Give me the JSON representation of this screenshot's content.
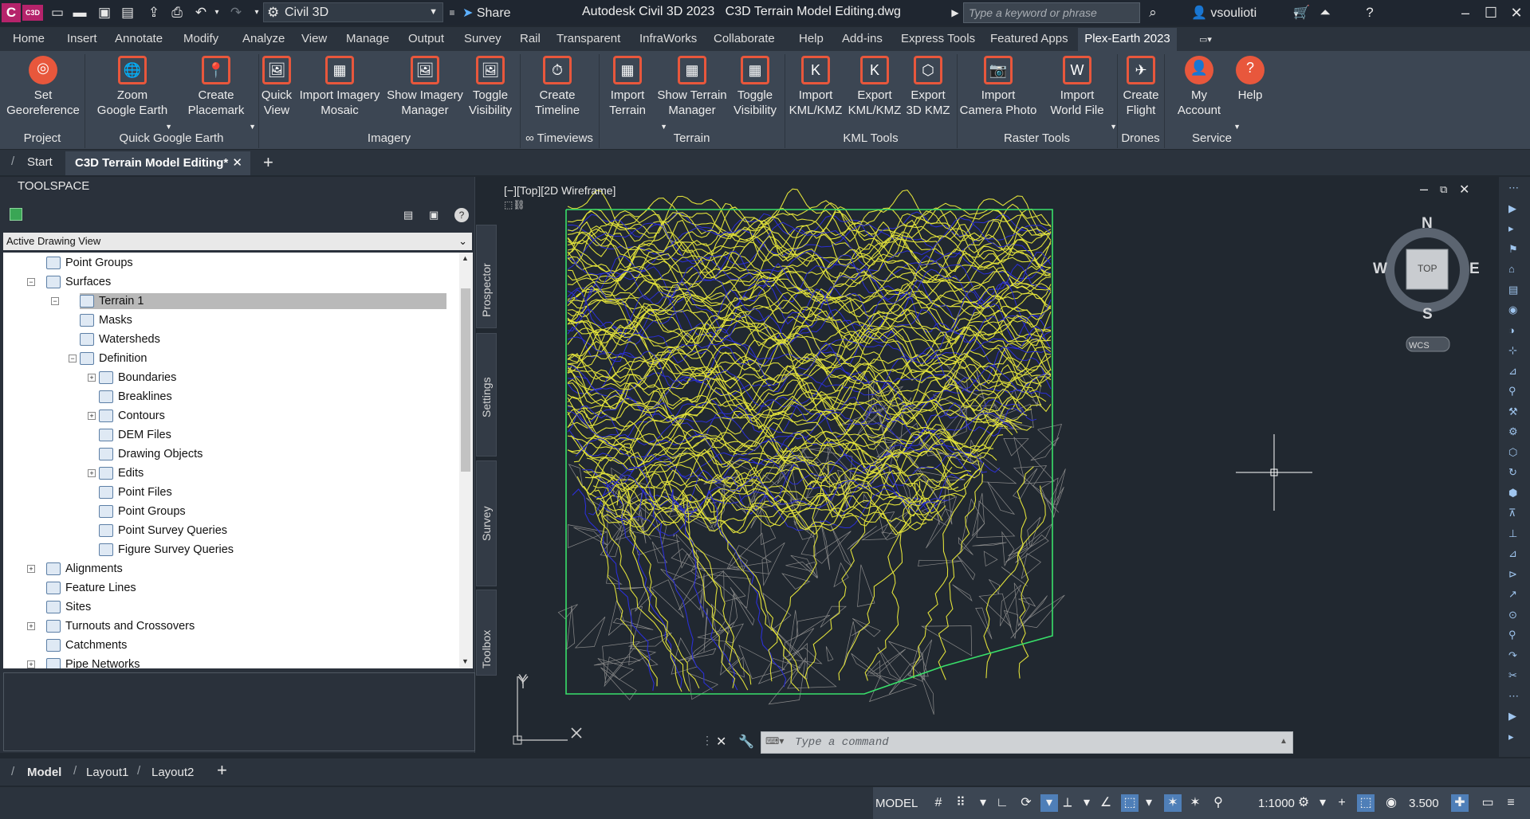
{
  "title_bar": {
    "logo": "C",
    "product_badge": "C3D",
    "workspace": "Civil 3D",
    "share": "Share",
    "app_title": "Autodesk Civil 3D 2023",
    "doc_title": "C3D Terrain Model Editing.dwg",
    "search_placeholder": "Type a keyword or phrase",
    "user": "vsoulioti"
  },
  "menu_tabs": [
    "Home",
    "Insert",
    "Annotate",
    "Modify",
    "Analyze",
    "View",
    "Manage",
    "Output",
    "Survey",
    "Rail",
    "Transparent",
    "InfraWorks",
    "Collaborate",
    "Help",
    "Add-ins",
    "Express Tools",
    "Featured Apps"
  ],
  "active_tab": "Plex-Earth 2023",
  "ribbon": {
    "buttons": [
      {
        "l1": "Set",
        "l2": "Georeference"
      },
      {
        "l1": "Zoom",
        "l2": "Google Earth"
      },
      {
        "l1": "Create",
        "l2": "Placemark"
      },
      {
        "l1": "Quick",
        "l2": "View"
      },
      {
        "l1": "Import Imagery",
        "l2": "Mosaic"
      },
      {
        "l1": "Show Imagery",
        "l2": "Manager"
      },
      {
        "l1": "Toggle",
        "l2": "Visibility"
      },
      {
        "l1": "Create",
        "l2": "Timeline"
      },
      {
        "l1": "Import",
        "l2": "Terrain"
      },
      {
        "l1": "Show Terrain",
        "l2": "Manager"
      },
      {
        "l1": "Toggle",
        "l2": "Visibility"
      },
      {
        "l1": "Import",
        "l2": "KML/KMZ"
      },
      {
        "l1": "Export",
        "l2": "KML/KMZ"
      },
      {
        "l1": "Export",
        "l2": "3D KMZ"
      },
      {
        "l1": "Import",
        "l2": "Camera Photo"
      },
      {
        "l1": "Import",
        "l2": "World File"
      },
      {
        "l1": "Create",
        "l2": "Flight"
      },
      {
        "l1": "My",
        "l2": "Account"
      },
      {
        "l1": "Help",
        "l2": ""
      }
    ],
    "groups": [
      "Project",
      "Quick Google Earth",
      "Imagery",
      "∞ Timeviews",
      "Terrain",
      "KML Tools",
      "Raster Tools",
      "Drones",
      "Service"
    ]
  },
  "doc_tabs": {
    "start": "Start",
    "active": "C3D Terrain Model Editing*"
  },
  "toolspace": {
    "title": "TOOLSPACE",
    "view": "Active Drawing View",
    "tree": [
      "Point Groups",
      "Surfaces",
      "Terrain 1",
      "Masks",
      "Watersheds",
      "Definition",
      "Boundaries",
      "Breaklines",
      "Contours",
      "DEM Files",
      "Drawing Objects",
      "Edits",
      "Point Files",
      "Point Groups",
      "Point Survey Queries",
      "Figure Survey Queries",
      "Alignments",
      "Feature Lines",
      "Sites",
      "Turnouts and Crossovers",
      "Catchments",
      "Pipe Networks"
    ],
    "side_tabs": [
      "Prospector",
      "Settings",
      "Survey",
      "Toolbox"
    ]
  },
  "viewport": {
    "label": "[−][Top][2D Wireframe]",
    "compass": {
      "n": "N",
      "s": "S",
      "e": "E",
      "w": "W",
      "top": "TOP"
    },
    "wcs": "WCS",
    "ucs_x": "X",
    "ucs_y": "Y"
  },
  "command": {
    "placeholder": "Type a command"
  },
  "layout_tabs": [
    "Model",
    "Layout1",
    "Layout2"
  ],
  "status": {
    "model": "MODEL",
    "scale": "1:1000",
    "weight": "3.500"
  },
  "colors": {
    "contour": "#e0e03a",
    "contour_minor": "#2b2fd6",
    "tin": "#8a8a8a",
    "boundary": "#39e06a",
    "accent": "#e8573c"
  }
}
